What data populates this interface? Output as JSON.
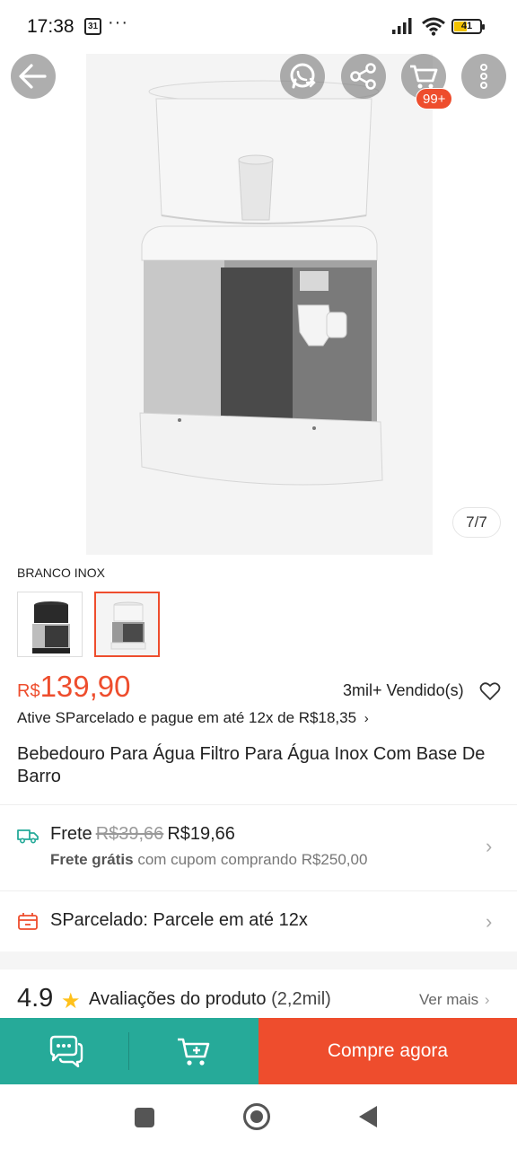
{
  "status_bar": {
    "time": "17:38",
    "calendar_day": "31",
    "more": "···",
    "battery": "41",
    "battery_color": "#f2c200"
  },
  "header": {
    "back_icon": "arrow-left-icon",
    "whatsapp_icon": "whatsapp-icon",
    "share_icon": "share-icon",
    "cart_icon": "cart-icon",
    "cart_badge": "99+",
    "more_icon": "more-vertical-icon"
  },
  "gallery": {
    "counter": "7/7",
    "image_desc": "water-filter-dispenser"
  },
  "variation": {
    "label": "BRANCO INOX",
    "options": [
      {
        "name": "preto-inox",
        "selected": false
      },
      {
        "name": "branco-inox",
        "selected": true
      }
    ]
  },
  "price": {
    "currency": "R$",
    "value": "139,90",
    "sold": "3mil+ Vendido(s)",
    "installment": "Ative SParcelado e pague em até 12x de R$18,35",
    "color": "#ee4d2d"
  },
  "product": {
    "title": "Bebedouro Para Água Filtro Para Água Inox Com Base De Barro"
  },
  "shipping": {
    "label": "Frete",
    "old_price": "R$39,66",
    "new_price": "R$19,66",
    "free_bold": "Frete grátis",
    "free_rest": "com cupom comprando R$250,00"
  },
  "sparcelado": {
    "label": "SParcelado: Parcele em até 12x"
  },
  "rating": {
    "score": "4.9",
    "label": "Avaliações do produto",
    "count": "(2,2mil)",
    "see_more": "Ver mais"
  },
  "actions": {
    "chat_icon": "chat-icon",
    "add_cart_icon": "add-to-cart-icon",
    "buy_label": "Compre agora",
    "teal": "#26aa99",
    "orange": "#ee4d2d"
  }
}
